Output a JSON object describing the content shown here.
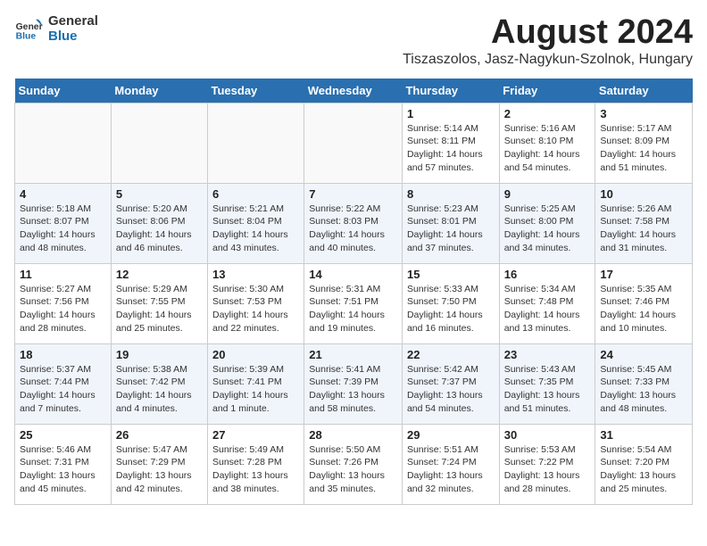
{
  "header": {
    "logo_general": "General",
    "logo_blue": "Blue",
    "month_title": "August 2024",
    "location": "Tiszaszolos, Jasz-Nagykun-Szolnok, Hungary"
  },
  "weekdays": [
    "Sunday",
    "Monday",
    "Tuesday",
    "Wednesday",
    "Thursday",
    "Friday",
    "Saturday"
  ],
  "weeks": [
    [
      {
        "day": "",
        "info": ""
      },
      {
        "day": "",
        "info": ""
      },
      {
        "day": "",
        "info": ""
      },
      {
        "day": "",
        "info": ""
      },
      {
        "day": "1",
        "info": "Sunrise: 5:14 AM\nSunset: 8:11 PM\nDaylight: 14 hours\nand 57 minutes."
      },
      {
        "day": "2",
        "info": "Sunrise: 5:16 AM\nSunset: 8:10 PM\nDaylight: 14 hours\nand 54 minutes."
      },
      {
        "day": "3",
        "info": "Sunrise: 5:17 AM\nSunset: 8:09 PM\nDaylight: 14 hours\nand 51 minutes."
      }
    ],
    [
      {
        "day": "4",
        "info": "Sunrise: 5:18 AM\nSunset: 8:07 PM\nDaylight: 14 hours\nand 48 minutes."
      },
      {
        "day": "5",
        "info": "Sunrise: 5:20 AM\nSunset: 8:06 PM\nDaylight: 14 hours\nand 46 minutes."
      },
      {
        "day": "6",
        "info": "Sunrise: 5:21 AM\nSunset: 8:04 PM\nDaylight: 14 hours\nand 43 minutes."
      },
      {
        "day": "7",
        "info": "Sunrise: 5:22 AM\nSunset: 8:03 PM\nDaylight: 14 hours\nand 40 minutes."
      },
      {
        "day": "8",
        "info": "Sunrise: 5:23 AM\nSunset: 8:01 PM\nDaylight: 14 hours\nand 37 minutes."
      },
      {
        "day": "9",
        "info": "Sunrise: 5:25 AM\nSunset: 8:00 PM\nDaylight: 14 hours\nand 34 minutes."
      },
      {
        "day": "10",
        "info": "Sunrise: 5:26 AM\nSunset: 7:58 PM\nDaylight: 14 hours\nand 31 minutes."
      }
    ],
    [
      {
        "day": "11",
        "info": "Sunrise: 5:27 AM\nSunset: 7:56 PM\nDaylight: 14 hours\nand 28 minutes."
      },
      {
        "day": "12",
        "info": "Sunrise: 5:29 AM\nSunset: 7:55 PM\nDaylight: 14 hours\nand 25 minutes."
      },
      {
        "day": "13",
        "info": "Sunrise: 5:30 AM\nSunset: 7:53 PM\nDaylight: 14 hours\nand 22 minutes."
      },
      {
        "day": "14",
        "info": "Sunrise: 5:31 AM\nSunset: 7:51 PM\nDaylight: 14 hours\nand 19 minutes."
      },
      {
        "day": "15",
        "info": "Sunrise: 5:33 AM\nSunset: 7:50 PM\nDaylight: 14 hours\nand 16 minutes."
      },
      {
        "day": "16",
        "info": "Sunrise: 5:34 AM\nSunset: 7:48 PM\nDaylight: 14 hours\nand 13 minutes."
      },
      {
        "day": "17",
        "info": "Sunrise: 5:35 AM\nSunset: 7:46 PM\nDaylight: 14 hours\nand 10 minutes."
      }
    ],
    [
      {
        "day": "18",
        "info": "Sunrise: 5:37 AM\nSunset: 7:44 PM\nDaylight: 14 hours\nand 7 minutes."
      },
      {
        "day": "19",
        "info": "Sunrise: 5:38 AM\nSunset: 7:42 PM\nDaylight: 14 hours\nand 4 minutes."
      },
      {
        "day": "20",
        "info": "Sunrise: 5:39 AM\nSunset: 7:41 PM\nDaylight: 14 hours\nand 1 minute."
      },
      {
        "day": "21",
        "info": "Sunrise: 5:41 AM\nSunset: 7:39 PM\nDaylight: 13 hours\nand 58 minutes."
      },
      {
        "day": "22",
        "info": "Sunrise: 5:42 AM\nSunset: 7:37 PM\nDaylight: 13 hours\nand 54 minutes."
      },
      {
        "day": "23",
        "info": "Sunrise: 5:43 AM\nSunset: 7:35 PM\nDaylight: 13 hours\nand 51 minutes."
      },
      {
        "day": "24",
        "info": "Sunrise: 5:45 AM\nSunset: 7:33 PM\nDaylight: 13 hours\nand 48 minutes."
      }
    ],
    [
      {
        "day": "25",
        "info": "Sunrise: 5:46 AM\nSunset: 7:31 PM\nDaylight: 13 hours\nand 45 minutes."
      },
      {
        "day": "26",
        "info": "Sunrise: 5:47 AM\nSunset: 7:29 PM\nDaylight: 13 hours\nand 42 minutes."
      },
      {
        "day": "27",
        "info": "Sunrise: 5:49 AM\nSunset: 7:28 PM\nDaylight: 13 hours\nand 38 minutes."
      },
      {
        "day": "28",
        "info": "Sunrise: 5:50 AM\nSunset: 7:26 PM\nDaylight: 13 hours\nand 35 minutes."
      },
      {
        "day": "29",
        "info": "Sunrise: 5:51 AM\nSunset: 7:24 PM\nDaylight: 13 hours\nand 32 minutes."
      },
      {
        "day": "30",
        "info": "Sunrise: 5:53 AM\nSunset: 7:22 PM\nDaylight: 13 hours\nand 28 minutes."
      },
      {
        "day": "31",
        "info": "Sunrise: 5:54 AM\nSunset: 7:20 PM\nDaylight: 13 hours\nand 25 minutes."
      }
    ]
  ]
}
